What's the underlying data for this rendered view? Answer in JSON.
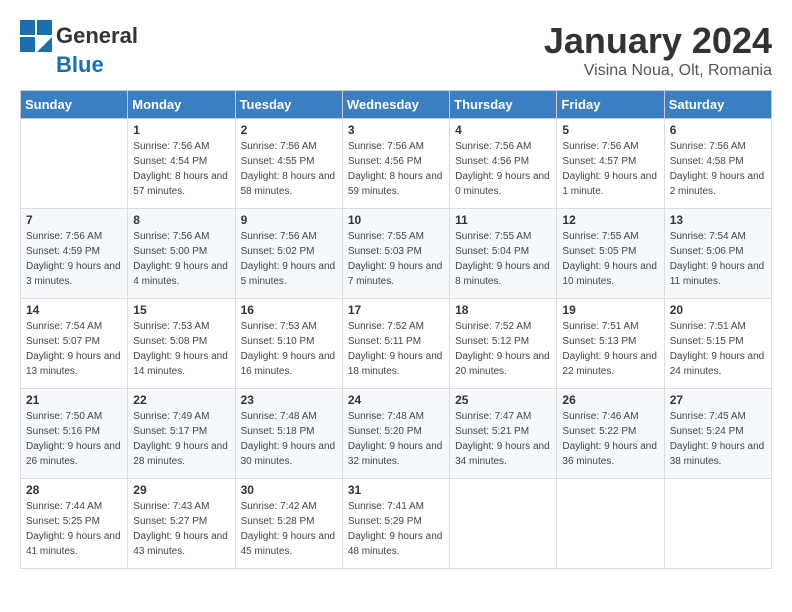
{
  "header": {
    "logo_general": "General",
    "logo_blue": "Blue",
    "month_title": "January 2024",
    "subtitle": "Visina Noua, Olt, Romania"
  },
  "days_of_week": [
    "Sunday",
    "Monday",
    "Tuesday",
    "Wednesday",
    "Thursday",
    "Friday",
    "Saturday"
  ],
  "weeks": [
    [
      {
        "day": "",
        "sunrise": "",
        "sunset": "",
        "daylight": ""
      },
      {
        "day": "1",
        "sunrise": "Sunrise: 7:56 AM",
        "sunset": "Sunset: 4:54 PM",
        "daylight": "Daylight: 8 hours and 57 minutes."
      },
      {
        "day": "2",
        "sunrise": "Sunrise: 7:56 AM",
        "sunset": "Sunset: 4:55 PM",
        "daylight": "Daylight: 8 hours and 58 minutes."
      },
      {
        "day": "3",
        "sunrise": "Sunrise: 7:56 AM",
        "sunset": "Sunset: 4:56 PM",
        "daylight": "Daylight: 8 hours and 59 minutes."
      },
      {
        "day": "4",
        "sunrise": "Sunrise: 7:56 AM",
        "sunset": "Sunset: 4:56 PM",
        "daylight": "Daylight: 9 hours and 0 minutes."
      },
      {
        "day": "5",
        "sunrise": "Sunrise: 7:56 AM",
        "sunset": "Sunset: 4:57 PM",
        "daylight": "Daylight: 9 hours and 1 minute."
      },
      {
        "day": "6",
        "sunrise": "Sunrise: 7:56 AM",
        "sunset": "Sunset: 4:58 PM",
        "daylight": "Daylight: 9 hours and 2 minutes."
      }
    ],
    [
      {
        "day": "7",
        "sunrise": "Sunrise: 7:56 AM",
        "sunset": "Sunset: 4:59 PM",
        "daylight": "Daylight: 9 hours and 3 minutes."
      },
      {
        "day": "8",
        "sunrise": "Sunrise: 7:56 AM",
        "sunset": "Sunset: 5:00 PM",
        "daylight": "Daylight: 9 hours and 4 minutes."
      },
      {
        "day": "9",
        "sunrise": "Sunrise: 7:56 AM",
        "sunset": "Sunset: 5:02 PM",
        "daylight": "Daylight: 9 hours and 5 minutes."
      },
      {
        "day": "10",
        "sunrise": "Sunrise: 7:55 AM",
        "sunset": "Sunset: 5:03 PM",
        "daylight": "Daylight: 9 hours and 7 minutes."
      },
      {
        "day": "11",
        "sunrise": "Sunrise: 7:55 AM",
        "sunset": "Sunset: 5:04 PM",
        "daylight": "Daylight: 9 hours and 8 minutes."
      },
      {
        "day": "12",
        "sunrise": "Sunrise: 7:55 AM",
        "sunset": "Sunset: 5:05 PM",
        "daylight": "Daylight: 9 hours and 10 minutes."
      },
      {
        "day": "13",
        "sunrise": "Sunrise: 7:54 AM",
        "sunset": "Sunset: 5:06 PM",
        "daylight": "Daylight: 9 hours and 11 minutes."
      }
    ],
    [
      {
        "day": "14",
        "sunrise": "Sunrise: 7:54 AM",
        "sunset": "Sunset: 5:07 PM",
        "daylight": "Daylight: 9 hours and 13 minutes."
      },
      {
        "day": "15",
        "sunrise": "Sunrise: 7:53 AM",
        "sunset": "Sunset: 5:08 PM",
        "daylight": "Daylight: 9 hours and 14 minutes."
      },
      {
        "day": "16",
        "sunrise": "Sunrise: 7:53 AM",
        "sunset": "Sunset: 5:10 PM",
        "daylight": "Daylight: 9 hours and 16 minutes."
      },
      {
        "day": "17",
        "sunrise": "Sunrise: 7:52 AM",
        "sunset": "Sunset: 5:11 PM",
        "daylight": "Daylight: 9 hours and 18 minutes."
      },
      {
        "day": "18",
        "sunrise": "Sunrise: 7:52 AM",
        "sunset": "Sunset: 5:12 PM",
        "daylight": "Daylight: 9 hours and 20 minutes."
      },
      {
        "day": "19",
        "sunrise": "Sunrise: 7:51 AM",
        "sunset": "Sunset: 5:13 PM",
        "daylight": "Daylight: 9 hours and 22 minutes."
      },
      {
        "day": "20",
        "sunrise": "Sunrise: 7:51 AM",
        "sunset": "Sunset: 5:15 PM",
        "daylight": "Daylight: 9 hours and 24 minutes."
      }
    ],
    [
      {
        "day": "21",
        "sunrise": "Sunrise: 7:50 AM",
        "sunset": "Sunset: 5:16 PM",
        "daylight": "Daylight: 9 hours and 26 minutes."
      },
      {
        "day": "22",
        "sunrise": "Sunrise: 7:49 AM",
        "sunset": "Sunset: 5:17 PM",
        "daylight": "Daylight: 9 hours and 28 minutes."
      },
      {
        "day": "23",
        "sunrise": "Sunrise: 7:48 AM",
        "sunset": "Sunset: 5:18 PM",
        "daylight": "Daylight: 9 hours and 30 minutes."
      },
      {
        "day": "24",
        "sunrise": "Sunrise: 7:48 AM",
        "sunset": "Sunset: 5:20 PM",
        "daylight": "Daylight: 9 hours and 32 minutes."
      },
      {
        "day": "25",
        "sunrise": "Sunrise: 7:47 AM",
        "sunset": "Sunset: 5:21 PM",
        "daylight": "Daylight: 9 hours and 34 minutes."
      },
      {
        "day": "26",
        "sunrise": "Sunrise: 7:46 AM",
        "sunset": "Sunset: 5:22 PM",
        "daylight": "Daylight: 9 hours and 36 minutes."
      },
      {
        "day": "27",
        "sunrise": "Sunrise: 7:45 AM",
        "sunset": "Sunset: 5:24 PM",
        "daylight": "Daylight: 9 hours and 38 minutes."
      }
    ],
    [
      {
        "day": "28",
        "sunrise": "Sunrise: 7:44 AM",
        "sunset": "Sunset: 5:25 PM",
        "daylight": "Daylight: 9 hours and 41 minutes."
      },
      {
        "day": "29",
        "sunrise": "Sunrise: 7:43 AM",
        "sunset": "Sunset: 5:27 PM",
        "daylight": "Daylight: 9 hours and 43 minutes."
      },
      {
        "day": "30",
        "sunrise": "Sunrise: 7:42 AM",
        "sunset": "Sunset: 5:28 PM",
        "daylight": "Daylight: 9 hours and 45 minutes."
      },
      {
        "day": "31",
        "sunrise": "Sunrise: 7:41 AM",
        "sunset": "Sunset: 5:29 PM",
        "daylight": "Daylight: 9 hours and 48 minutes."
      },
      {
        "day": "",
        "sunrise": "",
        "sunset": "",
        "daylight": ""
      },
      {
        "day": "",
        "sunrise": "",
        "sunset": "",
        "daylight": ""
      },
      {
        "day": "",
        "sunrise": "",
        "sunset": "",
        "daylight": ""
      }
    ]
  ]
}
